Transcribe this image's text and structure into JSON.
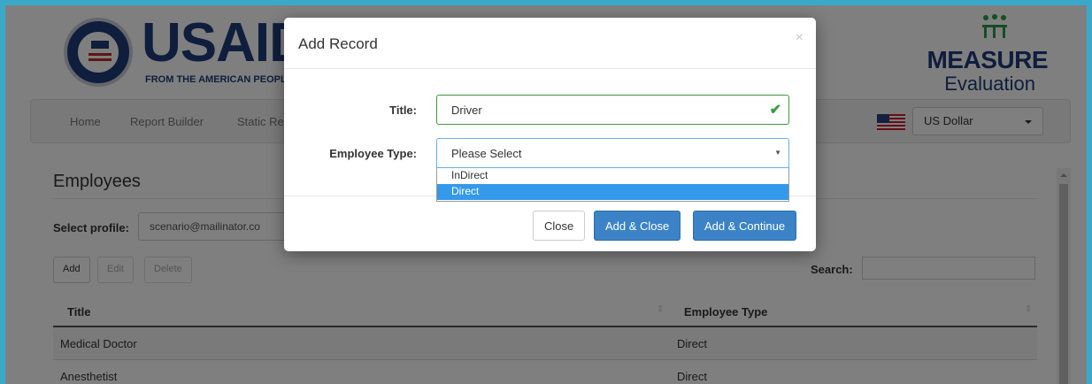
{
  "header": {
    "usaid_wordmark": "USAID",
    "usaid_tagline": "FROM THE AMERICAN PEOPLE",
    "measure_title": "MEASURE",
    "measure_subtitle": "Evaluation"
  },
  "nav": {
    "items": [
      "Home",
      "Report Builder",
      "Static Re"
    ],
    "currency": "US Dollar"
  },
  "main": {
    "section_title": "Employees",
    "profile_label": "Select profile:",
    "profile_value": "scenario@mailinator.co",
    "buttons": {
      "add": "Add",
      "edit": "Edit",
      "delete": "Delete"
    },
    "search_label": "Search:",
    "table": {
      "columns": [
        "Title",
        "Employee Type"
      ],
      "rows": [
        [
          "Medical Doctor",
          "Direct"
        ],
        [
          "Anesthetist",
          "Direct"
        ]
      ]
    }
  },
  "modal": {
    "title": "Add Record",
    "close_icon": "×",
    "fields": {
      "title_label": "Title:",
      "title_value": "Driver",
      "type_label": "Employee Type:",
      "type_value": "Please Select",
      "type_options": [
        "InDirect",
        "Direct"
      ],
      "type_highlighted": "Direct"
    },
    "footer": {
      "close": "Close",
      "add_close": "Add & Close",
      "add_continue": "Add & Continue"
    }
  },
  "colors": {
    "frame": "#3aa9c9",
    "brand_navy": "#1f3d7a",
    "primary_button": "#3b83c6",
    "valid_green": "#3c9a3c",
    "option_highlight": "#3399ea"
  }
}
